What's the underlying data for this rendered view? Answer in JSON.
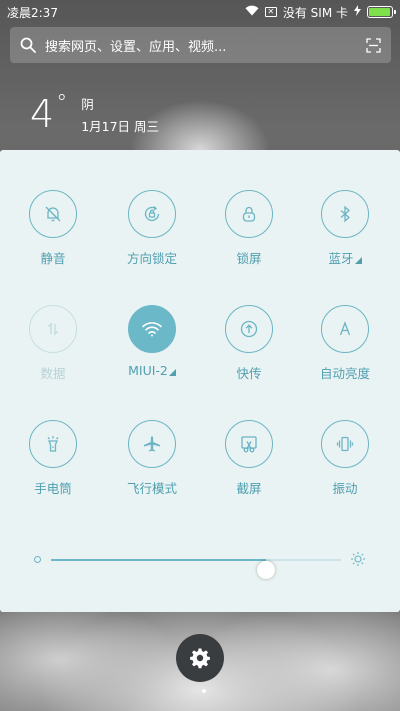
{
  "status_bar": {
    "time": "凌晨2:37",
    "no_sim_text": "没有 SIM 卡",
    "battery_level": 0.95,
    "battery_color": "#7ee04a",
    "icons": [
      "wifi-icon",
      "sim-x-icon",
      "charging-icon",
      "battery-icon"
    ]
  },
  "search": {
    "placeholder": "搜索网页、设置、应用、视频..."
  },
  "weather": {
    "temperature": "4",
    "unit": "°",
    "condition": "阴",
    "date": "1月17日 周三"
  },
  "tiles": [
    {
      "label": "静音",
      "icon": "silent-bell-icon",
      "state": "off"
    },
    {
      "label": "方向锁定",
      "icon": "rotation-lock-icon",
      "state": "off"
    },
    {
      "label": "锁屏",
      "icon": "lock-icon",
      "state": "off"
    },
    {
      "label": "蓝牙",
      "icon": "bluetooth-icon",
      "state": "off",
      "expandable": true
    },
    {
      "label": "数据",
      "icon": "mobile-data-icon",
      "state": "disabled"
    },
    {
      "label": "MIUI-2",
      "icon": "wifi-icon",
      "state": "on",
      "expandable": true
    },
    {
      "label": "快传",
      "icon": "quick-transfer-icon",
      "state": "off"
    },
    {
      "label": "自动亮度",
      "icon": "auto-brightness-icon",
      "state": "off"
    },
    {
      "label": "手电筒",
      "icon": "flashlight-icon",
      "state": "off"
    },
    {
      "label": "飞行模式",
      "icon": "airplane-icon",
      "state": "off"
    },
    {
      "label": "截屏",
      "icon": "screenshot-icon",
      "state": "off"
    },
    {
      "label": "振动",
      "icon": "vibrate-icon",
      "state": "off"
    }
  ],
  "brightness": {
    "level": 0.74
  },
  "colors": {
    "accent": "#6bb8c8",
    "label": "#4f9fb0",
    "panel_bg": "#eaf3f3",
    "settings_bg": "#3a3d40"
  }
}
